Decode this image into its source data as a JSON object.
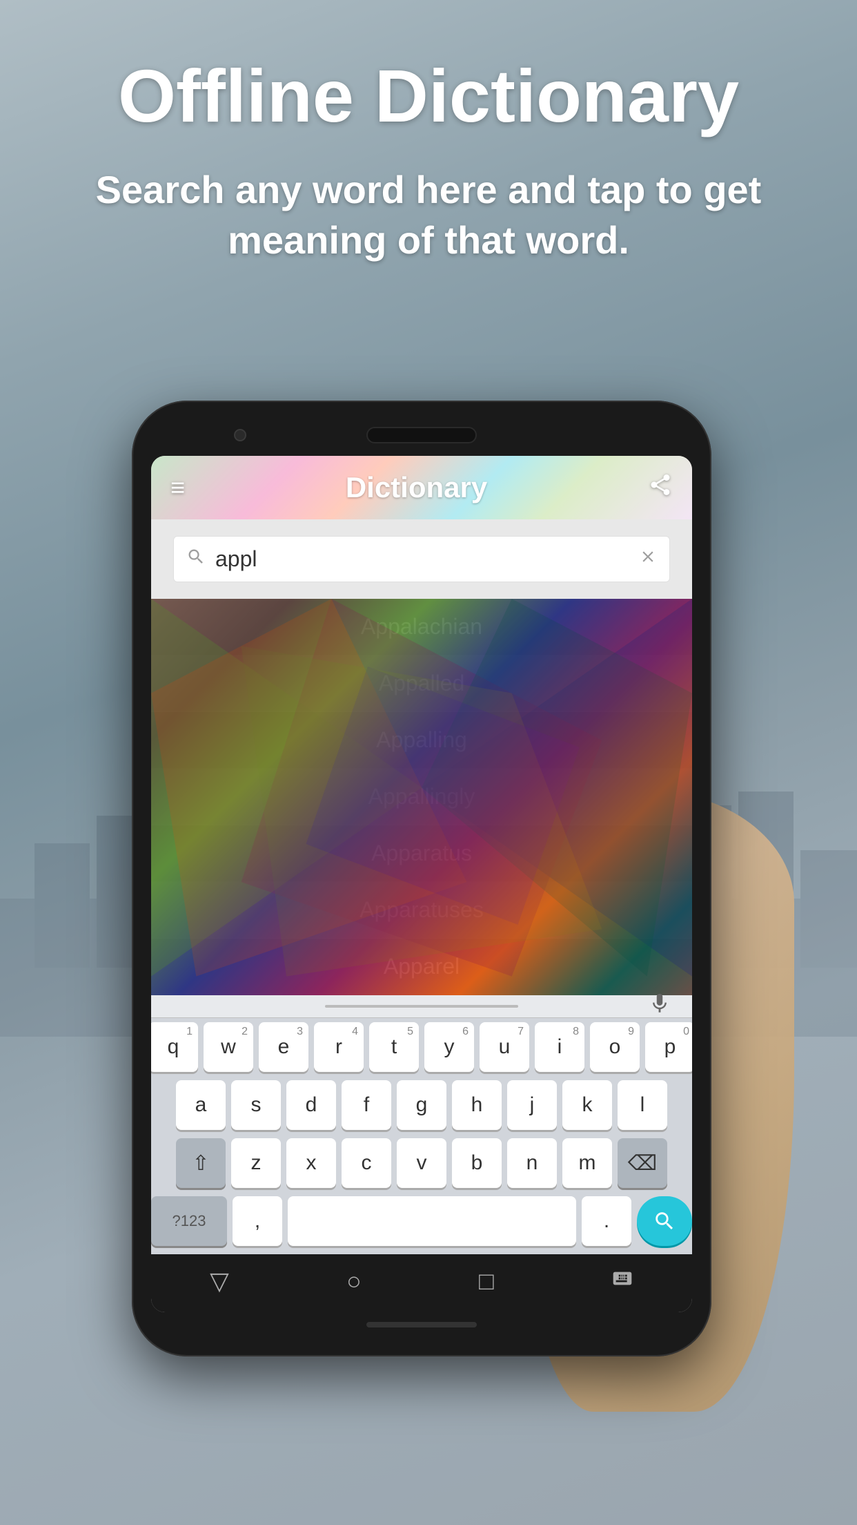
{
  "background": {
    "color_top": "#b0bec5",
    "color_bottom": "#7a8a9a"
  },
  "header": {
    "title": "Offline Dictionary",
    "subtitle": "Search any word here and tap to get meaning of that word."
  },
  "app": {
    "title": "Dictionary",
    "search_placeholder": "appl",
    "search_value": "appl"
  },
  "word_list": {
    "items": [
      "Appalachian",
      "Appalled",
      "Appalling",
      "Appallingly",
      "Apparatus",
      "Apparatuses",
      "Apparel"
    ]
  },
  "keyboard": {
    "rows": [
      {
        "keys": [
          {
            "num": "1",
            "letter": "q"
          },
          {
            "num": "2",
            "letter": "w"
          },
          {
            "num": "3",
            "letter": "e"
          },
          {
            "num": "4",
            "letter": "r"
          },
          {
            "num": "5",
            "letter": "t"
          },
          {
            "num": "6",
            "letter": "y"
          },
          {
            "num": "7",
            "letter": "u"
          },
          {
            "num": "8",
            "letter": "i"
          },
          {
            "num": "9",
            "letter": "o"
          },
          {
            "num": "0",
            "letter": "p"
          }
        ]
      },
      {
        "keys": [
          {
            "letter": "a"
          },
          {
            "letter": "s"
          },
          {
            "letter": "d"
          },
          {
            "letter": "f"
          },
          {
            "letter": "g"
          },
          {
            "letter": "h"
          },
          {
            "letter": "j"
          },
          {
            "letter": "k"
          },
          {
            "letter": "l"
          }
        ]
      },
      {
        "keys": [
          {
            "letter": "⇧",
            "type": "dark"
          },
          {
            "letter": "z"
          },
          {
            "letter": "x"
          },
          {
            "letter": "c"
          },
          {
            "letter": "v"
          },
          {
            "letter": "b"
          },
          {
            "letter": "n"
          },
          {
            "letter": "m"
          },
          {
            "letter": "⌫",
            "type": "dark"
          }
        ]
      },
      {
        "keys": [
          {
            "letter": "?123",
            "type": "dark wide"
          },
          {
            "letter": ","
          },
          {
            "letter": "",
            "type": "space"
          },
          {
            "letter": "."
          },
          {
            "letter": "🔍",
            "type": "search"
          }
        ]
      }
    ],
    "num_row": [
      "1",
      "2",
      "3",
      "4",
      "5",
      "6",
      "7",
      "8",
      "9",
      "0"
    ],
    "row1": [
      "q",
      "w",
      "e",
      "r",
      "t",
      "y",
      "u",
      "i",
      "o",
      "p"
    ],
    "row2": [
      "a",
      "s",
      "d",
      "f",
      "g",
      "h",
      "j",
      "k",
      "l"
    ],
    "row3_left": "⇧",
    "row3": [
      "z",
      "x",
      "c",
      "v",
      "b",
      "n",
      "m"
    ],
    "row3_right": "⌫",
    "bottom_left": "?123",
    "comma": ",",
    "period": ".",
    "search_btn": "🔍"
  },
  "bottom_nav": {
    "back": "▽",
    "home": "○",
    "recents": "□",
    "keyboard": "⌨"
  },
  "icons": {
    "menu": "≡",
    "share": "⇧",
    "search": "🔍",
    "clear": "✕",
    "mic": "🎤"
  }
}
